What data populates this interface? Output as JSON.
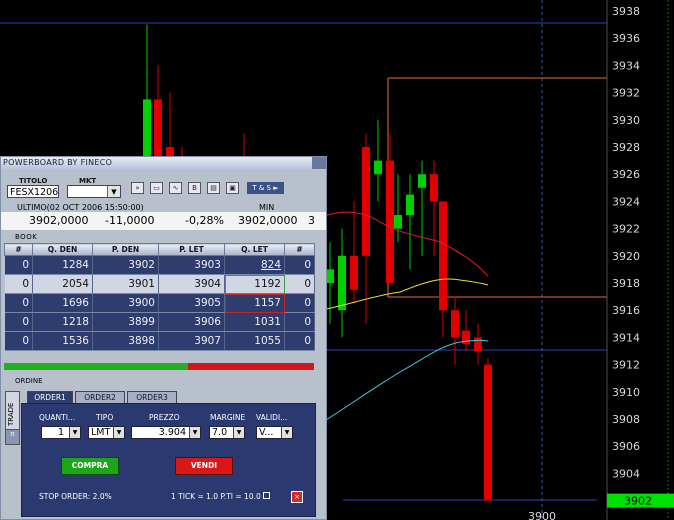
{
  "chart": {
    "price_axis_labels": [
      "3938",
      "3936",
      "3934",
      "3932",
      "3930",
      "3928",
      "3926",
      "3924",
      "3922",
      "3920",
      "3918",
      "3916",
      "3914",
      "3912",
      "3910",
      "3908",
      "3906",
      "3904"
    ],
    "last_price": "3902",
    "x_label": "3900",
    "colors": {
      "up": "#00d000",
      "down": "#e00000",
      "ma_red": "#e02020",
      "ma_yellow": "#e8e040",
      "ma_cyan": "#40c8e0",
      "last_bg": "#00e000"
    }
  },
  "panel": {
    "title": "POWERBOARD BY FINECO",
    "symbol_label": "TITOLO",
    "symbol_value": "FESX1206",
    "market_label": "MKT",
    "market_value": "",
    "ts_button": "T & S ►",
    "toolbar_icons": [
      "forward-icon",
      "window-icon",
      "chart-icon",
      "b-icon",
      "doc-icon",
      "save-icon"
    ],
    "quote": {
      "header_last": "ULTIMO(02 OCT 2006 15:50:00)",
      "header_min": "MIN",
      "last": "3902,0000",
      "change": "-11,0000",
      "pct": "-0,28%",
      "min": "3902,0000",
      "extra": "3"
    },
    "book_label": "BOOK",
    "book_headers": [
      "#",
      "Q. DEN",
      "P. DEN",
      "P. LET",
      "Q. LET",
      "#"
    ],
    "book_rows": [
      [
        "0",
        "1284",
        "3902",
        "3903",
        "824",
        "0"
      ],
      [
        "0",
        "2054",
        "3901",
        "3904",
        "1192",
        "0"
      ],
      [
        "0",
        "1696",
        "3900",
        "3905",
        "1157",
        "0"
      ],
      [
        "0",
        "1218",
        "3899",
        "3906",
        "1031",
        "0"
      ],
      [
        "0",
        "1536",
        "3898",
        "3907",
        "1055",
        "0"
      ]
    ],
    "order_label": "ORDINE",
    "trade_tab": "TRADE",
    "n_tab": "n",
    "tabs": [
      "ORDER1",
      "ORDER2",
      "ORDER3"
    ],
    "fields": {
      "qty_label": "QUANTI...",
      "qty_value": "1",
      "type_label": "TIPO",
      "type_value": "LMT",
      "price_label": "PREZZO",
      "price_value": "3.904",
      "margin_label": "MARGINE",
      "margin_value": "7.0",
      "valid_label": "VALIDI...",
      "valid_value": "V..."
    },
    "buy_button": "COMPRA",
    "sell_button": "VENDI",
    "stop_order": "STOP ORDER: 2.0%",
    "tick_info": "1 TICK = 1.0 P.TI = 10.0"
  }
}
